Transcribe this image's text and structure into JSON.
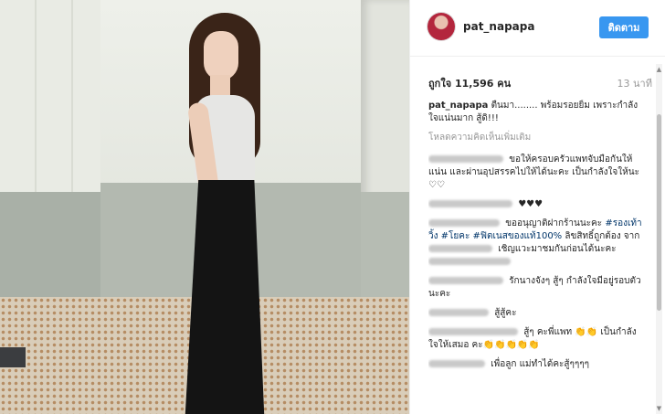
{
  "post": {
    "username": "pat_napapa",
    "follow_label": "ติดตาม",
    "likes": "ถูกใจ 11,596 คน",
    "time": "13 นาที"
  },
  "caption": {
    "username": "pat_napapa",
    "text": "ตื่นมา........ พร้อมรอยยิ้ม เพราะกำลังใจแน่นมาก สู้ดิ!!!"
  },
  "load_more": "โหลดความคิดเห็นเพิ่มเติม",
  "comments": [
    {
      "text": "ขอให้ครอบครัวแพทจับมือกันให้แน่น และผ่านอุปสรรคไปให้ได้นะคะ เป็นกำลังใจให้นะ ♡♡"
    },
    {
      "text": "♥♥♥"
    },
    {
      "text": "ขออนุญาติฝากร้านนะคะ",
      "hashtags": "#รองเท้าวิ้ง #โยคะ #ฟิตเนสของแท้100%",
      "text2": "ลิขสิทธิ์ถูกต้อง จาก",
      "text3": "เชิญแวะมาชมกันก่อนได้นะคะ"
    },
    {
      "text": "รักนางจังๆ สู้ๆ กำลังใจมีอยู่รอบตัวนะคะ"
    },
    {
      "text": "สู้สู้คะ"
    },
    {
      "text": "สู้ๆ คะพี่แพท 👏👏 เป็นกำลังใจให้เสมอ คะ👏👏👏👏👏"
    },
    {
      "text": "เพื่อลูก แม่ทำได้คะสู้ๆๆๆๆ"
    }
  ],
  "colors": {
    "follow_button": "#3897f0",
    "hashtag": "#003569",
    "muted": "#999999"
  },
  "icons": {
    "avatar": "profile-photo",
    "scroll_up": "triangle-up",
    "scroll_down": "triangle-down"
  }
}
